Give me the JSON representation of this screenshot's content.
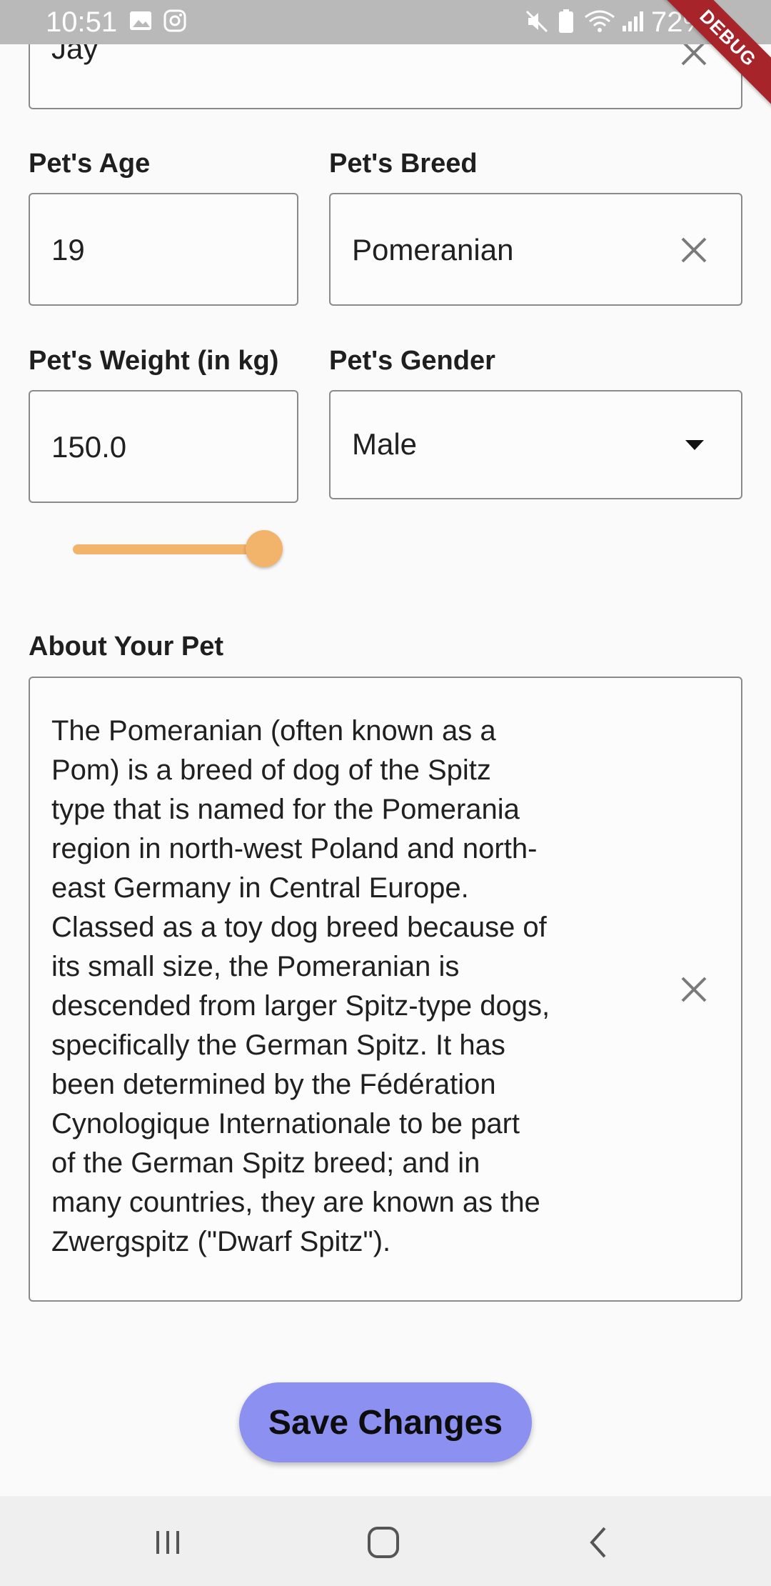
{
  "status_bar": {
    "time": "10:51",
    "battery": "72%",
    "icons": [
      "gallery-icon",
      "instagram-icon",
      "mute-icon",
      "battery-saver-icon",
      "wifi-icon",
      "signal-icon",
      "battery-icon"
    ]
  },
  "debug_banner": "DEBUG",
  "name_field": {
    "value": "Jay"
  },
  "age": {
    "label": "Pet's Age",
    "value": "19"
  },
  "breed": {
    "label": "Pet's Breed",
    "value": "Pomeranian"
  },
  "weight": {
    "label": "Pet's Weight (in kg)",
    "value": "150.0",
    "slider_fraction": 1.0
  },
  "gender": {
    "label": "Pet's Gender",
    "value": "Male"
  },
  "about": {
    "label": "About Your Pet",
    "value": "The Pomeranian (often known as a\nPom) is a breed of dog of the Spitz\ntype that is named for the Pomerania\nregion in north-west Poland and north-\neast Germany in Central Europe.\nClassed as a toy dog breed because of\nits small size, the Pomeranian is\ndescended from larger Spitz-type dogs,\nspecifically the German Spitz. It has\nbeen determined by the Fédération\nCynologique Internationale to be part\nof the German Spitz breed; and in\nmany countries, they are known as the\nZwergspitz (\"Dwarf Spitz\")."
  },
  "save_button": {
    "label": "Save Changes"
  },
  "colors": {
    "accent_orange": "#f2b36a",
    "button_purple": "#8c90f0",
    "debug_red": "#a8242b"
  }
}
